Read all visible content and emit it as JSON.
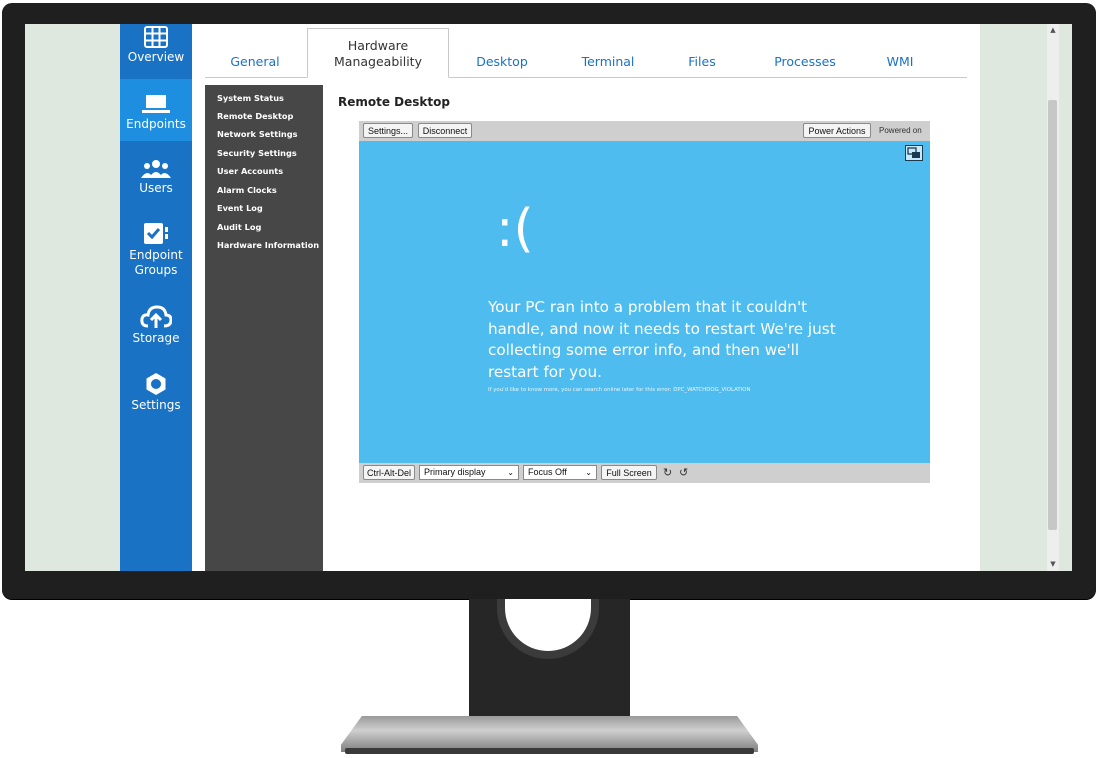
{
  "tabs": [
    {
      "label": "General"
    },
    {
      "label": "Hardware Manageability"
    },
    {
      "label": "Desktop"
    },
    {
      "label": "Terminal"
    },
    {
      "label": "Files"
    },
    {
      "label": "Processes"
    },
    {
      "label": "WMI"
    }
  ],
  "nav": {
    "items": [
      {
        "label": "Overview",
        "icon": "grid-icon"
      },
      {
        "label": "Endpoints",
        "icon": "laptop-icon",
        "active": true
      },
      {
        "label": "Users",
        "icon": "users-icon"
      },
      {
        "label": "Endpoint Groups",
        "icon": "checkbox-icon"
      },
      {
        "label": "Storage",
        "icon": "cloud-upload-icon"
      },
      {
        "label": "Settings",
        "icon": "gear-icon"
      }
    ]
  },
  "subnav": {
    "items": [
      {
        "label": "System Status"
      },
      {
        "label": "Remote Desktop"
      },
      {
        "label": "Network Settings"
      },
      {
        "label": "Security Settings"
      },
      {
        "label": "User Accounts"
      },
      {
        "label": "Alarm Clocks"
      },
      {
        "label": "Event Log"
      },
      {
        "label": "Audit Log"
      },
      {
        "label": "Hardware Information"
      }
    ]
  },
  "main": {
    "title": "Remote Desktop"
  },
  "viewer": {
    "settings_label": "Settings...",
    "disconnect_label": "Disconnect",
    "power_actions_label": "Power Actions",
    "power_status": "Powered on",
    "ctrl_alt_del_label": "Ctrl-Alt-Del",
    "display_select": "Primary display",
    "focus_select": "Focus Off",
    "full_screen_label": "Full Screen",
    "bsod_face": ":(",
    "bsod_message": "Your PC ran into a problem that it couldn't handle, and now it needs to restart We're just collecting some error info, and then we'll restart for you.",
    "bsod_detail": "If you'd like to know more, you can search online later for this error: DPC_WATCHDOG_VIOLATION",
    "screen_color": "#4ebcee"
  },
  "colors": {
    "nav_bg": "#1a72c4",
    "nav_active": "#1e8fe0",
    "tab_link": "#1a72c4",
    "subnav_bg": "#474747"
  }
}
